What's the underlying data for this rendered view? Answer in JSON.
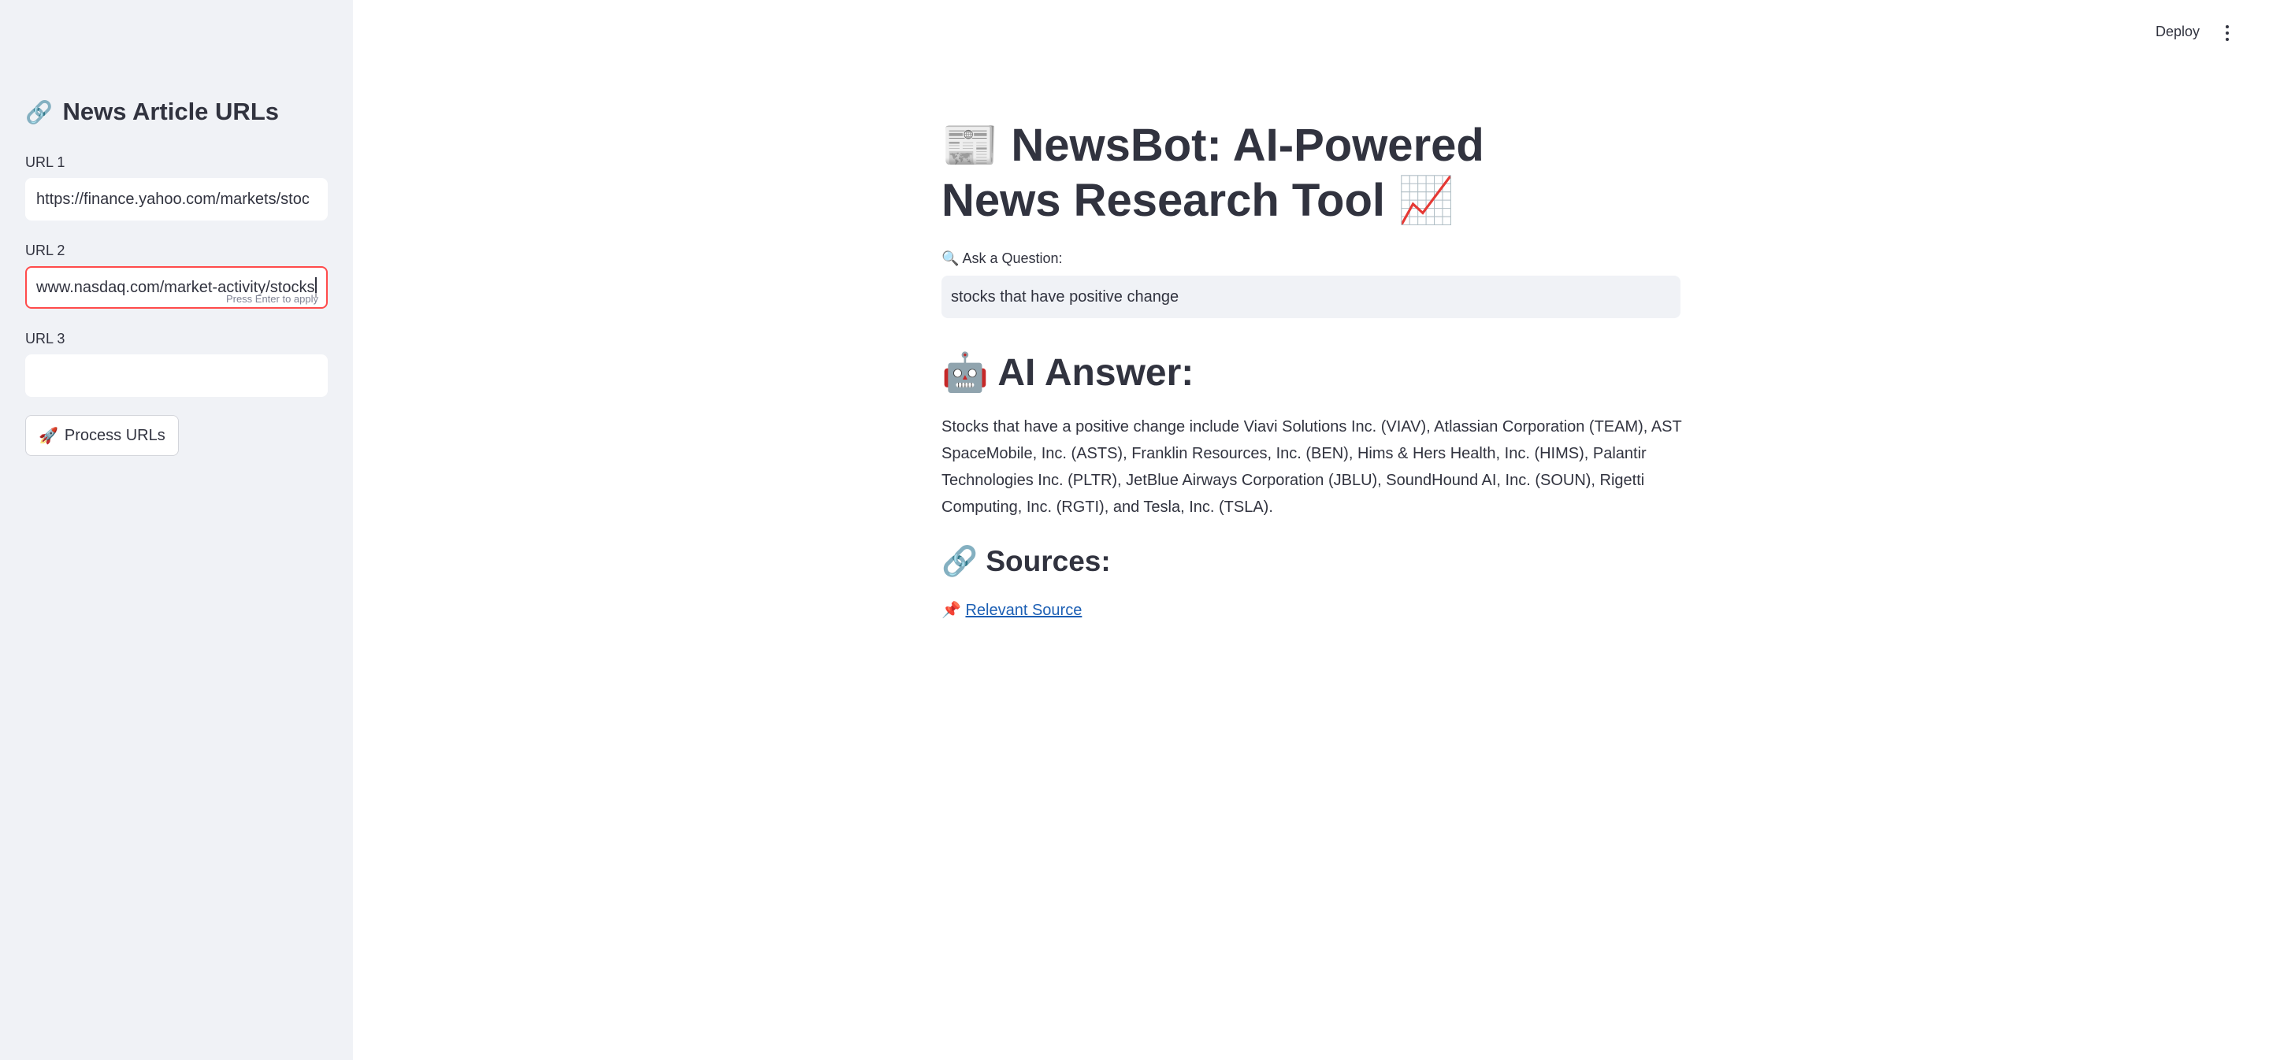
{
  "header": {
    "deploy_label": "Deploy",
    "menu_icon": "more-vertical-icon"
  },
  "sidebar": {
    "title_icon": "🔗",
    "title": "News Article URLs",
    "url1": {
      "label": "URL 1",
      "value": "https://finance.yahoo.com/markets/stoc"
    },
    "url2": {
      "label": "URL 2",
      "value": "www.nasdaq.com/market-activity/stocks",
      "hint": "Press Enter to apply"
    },
    "url3": {
      "label": "URL 3",
      "value": ""
    },
    "process_button": {
      "icon": "🚀",
      "label": "Process URLs"
    }
  },
  "main": {
    "title_icon_left": "📰",
    "title": "NewsBot: AI-Powered News Research Tool",
    "title_icon_right": "📈",
    "question": {
      "icon": "🔍",
      "label": "Ask a Question:",
      "value": "stocks that have positive change"
    },
    "answer": {
      "icon": "🤖",
      "heading": "AI Answer:",
      "text": "Stocks that have a positive change include Viavi Solutions Inc. (VIAV), Atlassian Corporation (TEAM), AST SpaceMobile, Inc. (ASTS), Franklin Resources, Inc. (BEN), Hims & Hers Health, Inc. (HIMS), Palantir Technologies Inc. (PLTR), JetBlue Airways Corporation (JBLU), SoundHound AI, Inc. (SOUN), Rigetti Computing, Inc. (RGTI), and Tesla, Inc. (TSLA)."
    },
    "sources": {
      "icon": "🔗",
      "heading": "Sources:",
      "pin_icon": "📌",
      "link_label": "Relevant Source"
    }
  },
  "colors": {
    "sidebar_bg": "#f0f2f6",
    "focus_border": "#ff4b4b",
    "link": "#1c5fb4",
    "text": "#31333f"
  }
}
